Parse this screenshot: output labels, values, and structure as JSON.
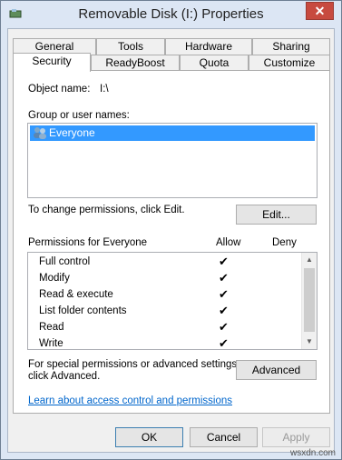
{
  "window": {
    "title": "Removable Disk (I:) Properties",
    "close_glyph": "✕"
  },
  "tabs": {
    "row_top": [
      "General",
      "Tools",
      "Hardware",
      "Sharing"
    ],
    "row_bottom": [
      "Security",
      "ReadyBoost",
      "Quota",
      "Customize"
    ],
    "active": "Security"
  },
  "security": {
    "object_name_label": "Object name:",
    "object_name_value": "I:\\",
    "group_label": "Group or user names:",
    "users": [
      {
        "name": "Everyone",
        "icon": "users-group-icon",
        "selected": true
      }
    ],
    "change_text": "To change permissions, click Edit.",
    "edit_button": "Edit...",
    "permissions_for": "Permissions for Everyone",
    "allow_header": "Allow",
    "deny_header": "Deny",
    "permissions": [
      {
        "name": "Full control",
        "allow": true,
        "deny": false
      },
      {
        "name": "Modify",
        "allow": true,
        "deny": false
      },
      {
        "name": "Read & execute",
        "allow": true,
        "deny": false
      },
      {
        "name": "List folder contents",
        "allow": true,
        "deny": false
      },
      {
        "name": "Read",
        "allow": true,
        "deny": false
      },
      {
        "name": "Write",
        "allow": true,
        "deny": false
      }
    ],
    "check_glyph": "✔",
    "special_text_1": "For special permissions or advanced settings,",
    "special_text_2": "click Advanced.",
    "advanced_button": "Advanced",
    "learn_link": "Learn about access control and permissions"
  },
  "footer": {
    "ok": "OK",
    "cancel": "Cancel",
    "apply": "Apply"
  },
  "watermark": "wsxdn.com",
  "colors": {
    "selection": "#3399ff",
    "link": "#0066cc",
    "close": "#c74a3f"
  }
}
